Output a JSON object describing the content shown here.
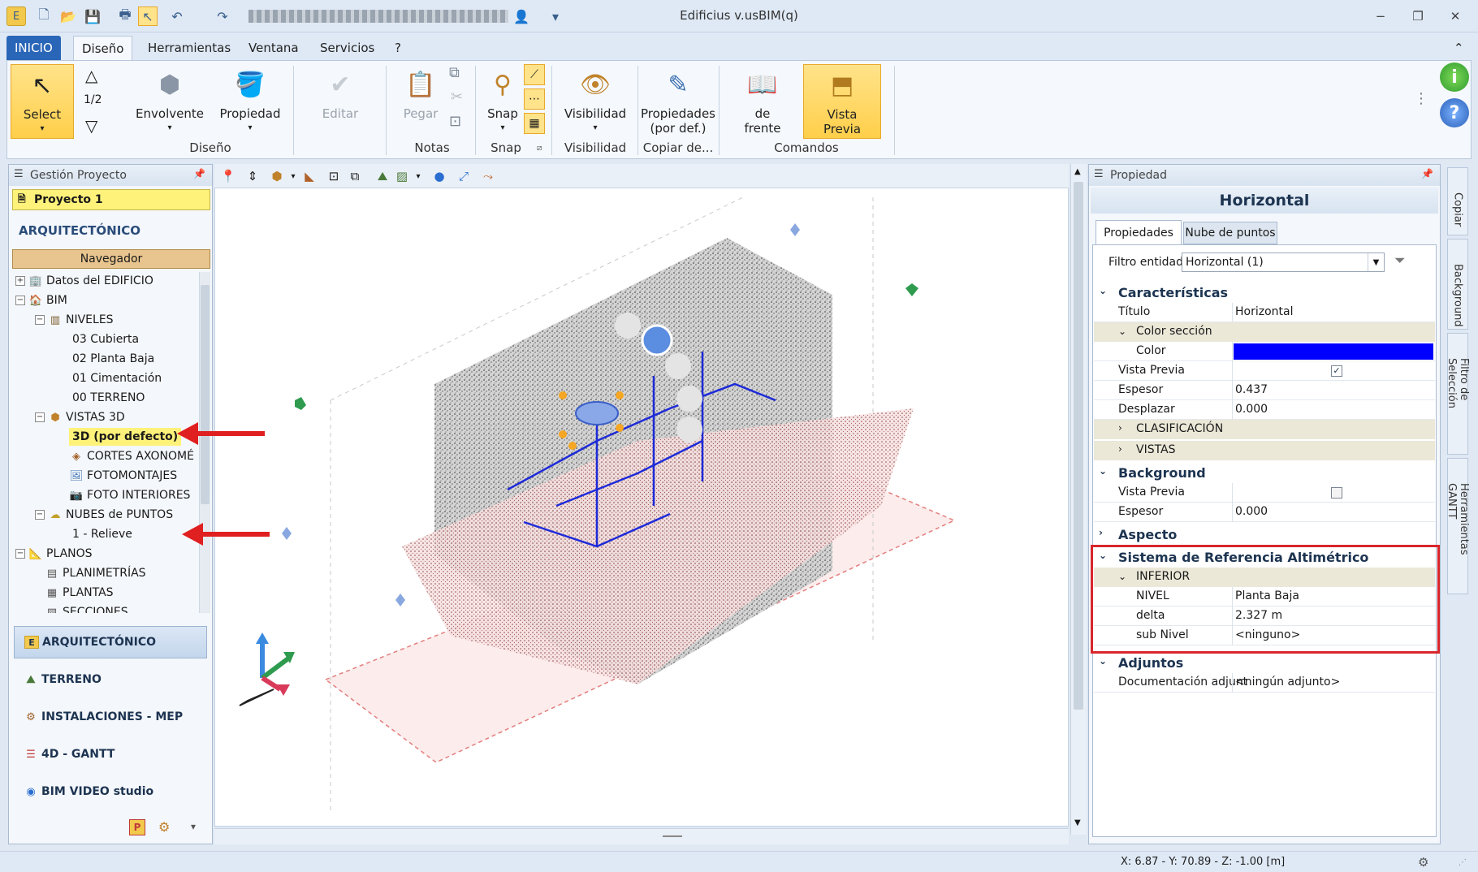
{
  "window": {
    "title": "Edificius v.usBIM(q)",
    "account_placeholder": "",
    "minimize_glyph": "−",
    "restore_glyph": "❐",
    "close_glyph": "✕",
    "collapse_glyph": "⌃"
  },
  "menu": {
    "tabs": [
      "INICIO",
      "Diseño",
      "Herramientas",
      "Ventana",
      "Servicios",
      "?"
    ]
  },
  "ribbon": {
    "select": "Select",
    "fraction": "1/2",
    "envolvente": "Envolvente",
    "propiedad": "Propiedad",
    "editar": "Editar",
    "pegar": "Pegar",
    "snap": "Snap",
    "visibilidad": "Visibilidad",
    "propiedades_def_1": "Propiedades",
    "propiedades_def_2": "(por def.)",
    "de_frente_1": "de",
    "de_frente_2": "frente",
    "vista_previa_1": "Vista",
    "vista_previa_2": "Previa",
    "groups": {
      "diseno": "Diseño",
      "notas": "Notas",
      "snap": "Snap",
      "visibilidad": "Visibilidad",
      "copiar": "Copiar de...",
      "comandos": "Comandos"
    }
  },
  "left_panel": {
    "header": "Gestión Proyecto",
    "project": "Proyecto 1",
    "section": "ARQUITECTÓNICO",
    "navigator": "Navegador",
    "tree": {
      "datos": "Datos del EDIFICIO",
      "bim": "BIM",
      "niveles": "NIVELES",
      "n03": "03 Cubierta",
      "n02": "02 Planta Baja",
      "n01": "01 Cimentación",
      "n00": "00 TERRENO",
      "vistas3d": "VISTAS 3D",
      "v3d_default": "3D (por defecto)",
      "cortes": "CORTES AXONOMÉ",
      "fotomontajes": "FOTOMONTAJES",
      "foto_interiores": "FOTO INTERIORES",
      "nubes": "NUBES de PUNTOS",
      "relieve": "1 - Relieve",
      "planos": "PLANOS",
      "planimetrias": "PLANIMETRÍAS",
      "plantas": "PLANTAS",
      "secciones": "SECCIONES"
    },
    "bottom_nav": [
      "ARQUITECTÓNICO",
      "TERRENO",
      "INSTALACIONES - MEP",
      "4D - GANTT",
      "BIM VIDEO studio"
    ]
  },
  "right_panel": {
    "header": "Propiedad",
    "title": "Horizontal",
    "tabs": [
      "Propiedades",
      "Nube de puntos"
    ],
    "filter_label": "Filtro entidad",
    "filter_value": "Horizontal (1)",
    "sections": {
      "caracteristicas": "Características",
      "background": "Background",
      "aspecto": "Aspecto",
      "sistema": "Sistema de Referencia Altimétrico",
      "adjuntos": "Adjuntos"
    },
    "rows": {
      "titulo_k": "Título",
      "titulo_v": "Horizontal",
      "color_seccion": "Color sección",
      "color_k": "Color",
      "vista_previa_k": "Vista Previa",
      "espesor_k": "Espesor",
      "espesor_v": "0.437",
      "desplazar_k": "Desplazar",
      "desplazar_v": "0.000",
      "clasificacion": "CLASIFICACIÓN",
      "vistas": "VISTAS",
      "bg_vista_previa_k": "Vista Previa",
      "bg_espesor_k": "Espesor",
      "bg_espesor_v": "0.000",
      "inferior": "INFERIOR",
      "nivel_k": "NIVEL",
      "nivel_v": "Planta Baja",
      "delta_k": "delta",
      "delta_v": "2.327 m",
      "subnivel_k": "sub Nivel",
      "subnivel_v": "<ninguno>",
      "doc_k": "Documentación adjunt",
      "doc_v": "<ningún adjunto>"
    },
    "color_value": "#0000ff"
  },
  "side_tabs": [
    "Copiar",
    "Background",
    "Filtro de Selección",
    "Herramientas GANTT"
  ],
  "status": {
    "coords": "X: 6.87 - Y: 70.89 - Z: -1.00 [m]"
  }
}
